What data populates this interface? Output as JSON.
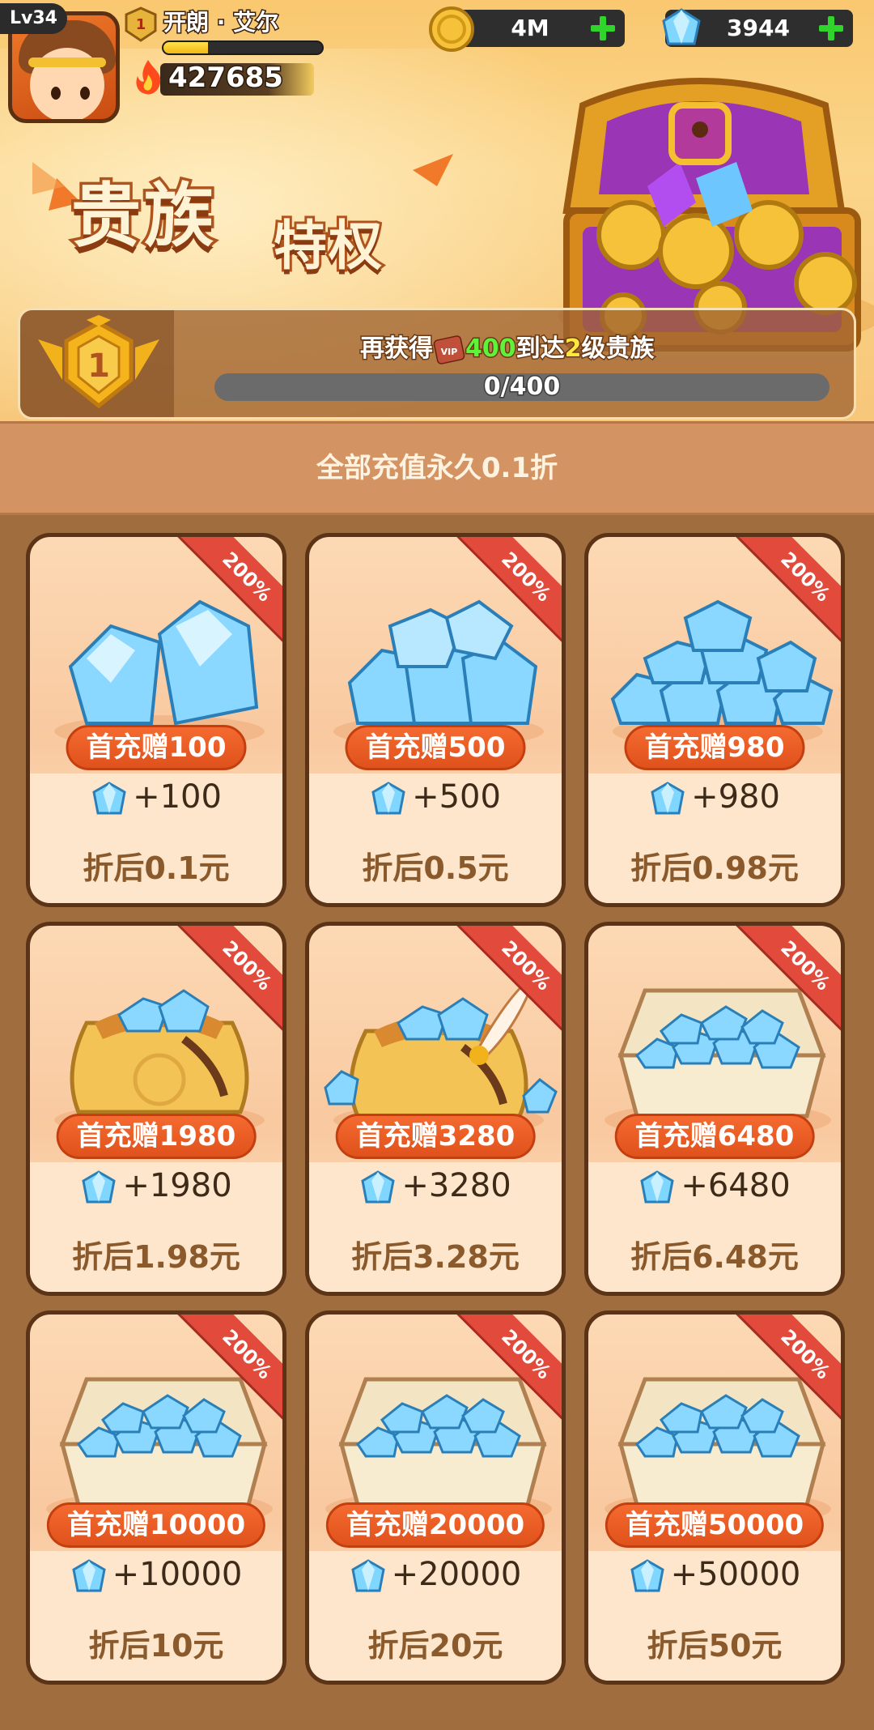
{
  "player": {
    "level": "Lv34",
    "vip_level": "1",
    "name": "开朗 · 艾尔",
    "xp_fraction": 0.28,
    "power": "427685"
  },
  "currencies": {
    "coins": "4M",
    "gems": "3944"
  },
  "banner": {
    "title_main": "贵族",
    "title_sub": "特权"
  },
  "vip": {
    "rank": "1",
    "msg_prefix": "再获得",
    "msg_amount": "400",
    "msg_mid": "到达",
    "msg_level": "2",
    "msg_suffix": "级贵族",
    "progress_text": "0/400",
    "progress_fraction": 0
  },
  "strip": {
    "text": "全部充值永久0.1折"
  },
  "colors": {
    "accent_green": "#5ff23a",
    "accent_yellow": "#ffe640",
    "ribbon_red": "#e24b3c",
    "pill_orange": "#f46a30",
    "card_border": "#5b3316"
  },
  "packs": [
    {
      "ribbon": "200%",
      "first": "首充赠100",
      "gems": "+100",
      "price": "折后0.1元",
      "art": "gems-small-icon"
    },
    {
      "ribbon": "200%",
      "first": "首充赠500",
      "gems": "+500",
      "price": "折后0.5元",
      "art": "gems-pile-icon"
    },
    {
      "ribbon": "200%",
      "first": "首充赠980",
      "gems": "+980",
      "price": "折后0.98元",
      "art": "gems-heap-icon"
    },
    {
      "ribbon": "200%",
      "first": "首充赠1980",
      "gems": "+1980",
      "price": "折后1.98元",
      "art": "gem-bag-icon"
    },
    {
      "ribbon": "200%",
      "first": "首充赠3280",
      "gems": "+3280",
      "price": "折后3.28元",
      "art": "gem-bag-feather-icon"
    },
    {
      "ribbon": "200%",
      "first": "首充赠6480",
      "gems": "+6480",
      "price": "折后6.48元",
      "art": "gem-box-icon"
    },
    {
      "ribbon": "200%",
      "first": "首充赠10000",
      "gems": "+10000",
      "price": "折后10元",
      "art": "gem-box-icon"
    },
    {
      "ribbon": "200%",
      "first": "首充赠20000",
      "gems": "+20000",
      "price": "折后20元",
      "art": "gem-box-icon"
    },
    {
      "ribbon": "200%",
      "first": "首充赠50000",
      "gems": "+50000",
      "price": "折后50元",
      "art": "gem-box-icon"
    }
  ]
}
